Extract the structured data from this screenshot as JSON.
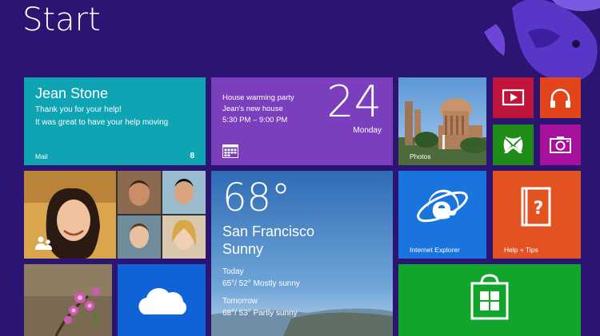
{
  "screen": {
    "title": "Start"
  },
  "mail": {
    "sender": "Jean Stone",
    "line1": "Thank you for your help!",
    "line2": "It was great to have your help moving",
    "label": "Mail",
    "count": "8"
  },
  "calendar": {
    "event_title": "House warming party",
    "event_location": "Jean's new house",
    "event_time": "5:30 PM – 9:00 PM",
    "day_number": "24",
    "day_name": "Monday"
  },
  "photos": {
    "label": "Photos"
  },
  "weather": {
    "temperature": "68°",
    "city": "San Francisco",
    "condition": "Sunny",
    "today_label": "Today",
    "today_forecast": "65°/ 52° Mostly sunny",
    "tomorrow_label": "Tomorrow",
    "tomorrow_forecast": "68°/ 53° Partly sunny"
  },
  "ie": {
    "label": "Internet Explorer"
  },
  "help": {
    "label": "Help + Tips"
  },
  "colors": {
    "background": "#2b1472",
    "mail": "#0ea4b4",
    "calendar": "#7b3fbd",
    "video": "#c1143c",
    "music": "#e2451c",
    "games": "#1e8c17",
    "camera": "#a6129c",
    "ie": "#1a74dd",
    "help": "#e25321",
    "onedrive": "#1062d7",
    "store": "#11a52b"
  },
  "icons": {
    "video": "video-icon",
    "music": "headphones-icon",
    "games": "xbox-icon",
    "camera": "camera-icon",
    "ie": "internet-explorer-icon",
    "help": "help-book-icon",
    "onedrive": "cloud-icon",
    "store": "store-bag-icon",
    "people": "people-icon",
    "calendar": "calendar-icon"
  }
}
